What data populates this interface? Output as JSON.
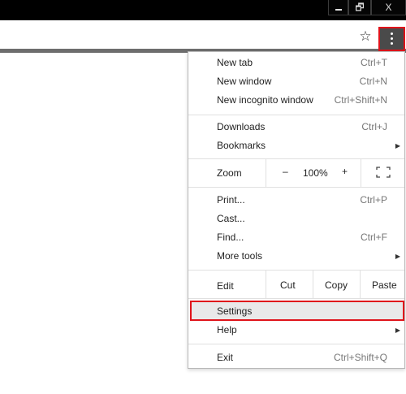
{
  "window": {
    "restore_glyph": "🗗",
    "close_glyph": "X"
  },
  "toolbar": {
    "star_glyph": "☆",
    "menu_icon": "vertical-ellipsis"
  },
  "menu": {
    "group1": [
      {
        "label": "New tab",
        "shortcut": "Ctrl+T"
      },
      {
        "label": "New window",
        "shortcut": "Ctrl+N"
      },
      {
        "label": "New incognito window",
        "shortcut": "Ctrl+Shift+N"
      }
    ],
    "group2": [
      {
        "label": "Downloads",
        "shortcut": "Ctrl+J"
      },
      {
        "label": "Bookmarks",
        "arrow": "▶"
      }
    ],
    "zoom": {
      "label": "Zoom",
      "minus": "–",
      "value": "100%",
      "plus": "+"
    },
    "group3": [
      {
        "label": "Print...",
        "shortcut": "Ctrl+P"
      },
      {
        "label": "Cast..."
      },
      {
        "label": "Find...",
        "shortcut": "Ctrl+F"
      },
      {
        "label": "More tools",
        "arrow": "▶"
      }
    ],
    "edit": {
      "label": "Edit",
      "cut": "Cut",
      "copy": "Copy",
      "paste": "Paste"
    },
    "settings": {
      "label": "Settings"
    },
    "help": {
      "label": "Help",
      "arrow": "▶"
    },
    "exit": {
      "label": "Exit",
      "shortcut": "Ctrl+Shift+Q"
    }
  },
  "colors": {
    "highlight_border": "#e0141b",
    "menu_button_bg": "#4a4a4a"
  }
}
